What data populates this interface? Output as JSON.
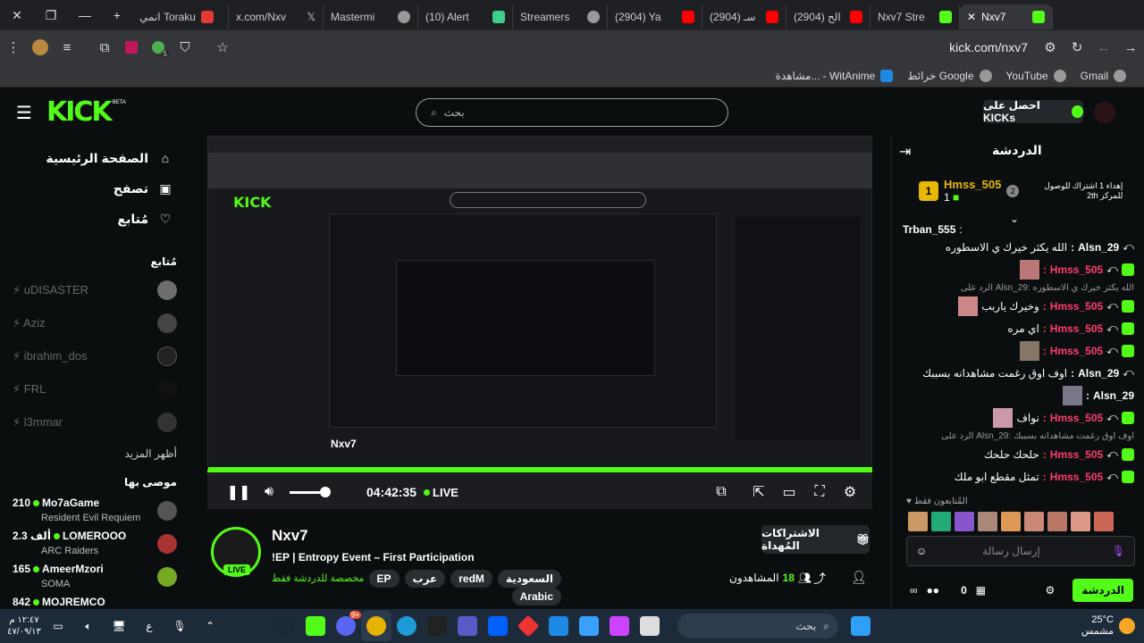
{
  "browser": {
    "tabs": [
      {
        "label": "انمي Toraku",
        "active": false
      },
      {
        "label": "x.com/Nxv",
        "active": false
      },
      {
        "label": "Mastermi",
        "active": false
      },
      {
        "label": "(10) Alert",
        "active": false
      },
      {
        "label": "Streamers",
        "active": false
      },
      {
        "label": "(2904) Ya",
        "active": false
      },
      {
        "label": "(2904) سـ",
        "active": false
      },
      {
        "label": "(2904) الح",
        "active": false
      },
      {
        "label": "Nxv7 Stre",
        "active": false
      },
      {
        "label": "Nxv7",
        "active": true
      }
    ],
    "url": "kick.com/nxv7",
    "extension_badge": "5",
    "bookmarks": [
      "Gmail",
      "YouTube",
      "خرائط Google",
      "مشاهدة... - WitAnime"
    ]
  },
  "header": {
    "logo": "KICK",
    "logo_beta": "BETA",
    "search_placeholder": "بحث",
    "get_kicks": "احصل على KICKs"
  },
  "sidebar": {
    "nav": [
      {
        "label": "الصفحة الرئيسية",
        "icon": "home-icon"
      },
      {
        "label": "تصفح",
        "icon": "browse-icon"
      },
      {
        "label": "مُتابع",
        "icon": "heart-icon"
      }
    ],
    "following_title": "مُتابع",
    "following": [
      "uDISASTER",
      "Aziz",
      "ibrahim_dos",
      "FRL",
      "l3mmar"
    ],
    "show_more": "أظهر المزيد",
    "recommended_title": "موصى بها",
    "recommended": [
      {
        "viewers": "210",
        "name": "Mo7aGame",
        "game": "Resident Evil Requiem"
      },
      {
        "viewers": "2.3 ألف",
        "name": "LOMEROOO",
        "game": "ARC Raiders"
      },
      {
        "viewers": "165",
        "name": "AmeerMzori",
        "game": "SOMA"
      },
      {
        "viewers": "842",
        "name": "MOJREMCO",
        "game": ""
      }
    ]
  },
  "player": {
    "time": "04:42:35",
    "live": "LIVE"
  },
  "stream": {
    "channel": "Nxv7",
    "title": "!EP | Entropy Event – First Participation",
    "avatar_live": "LIVE",
    "chat_only": "مخصصة للدردشة فقط",
    "tags": [
      "السعودية",
      "redM",
      "عرب",
      "EP",
      "Arabic"
    ],
    "gift_subs": "الاشتراكات المُهداة",
    "viewers_label": "المشاهدون",
    "viewers": "18"
  },
  "chat": {
    "title": "الدردشة",
    "pinned_text": "إهداء 1 اشتراك للوصول للمركز 2th",
    "gifter_name": "Hmss_505",
    "gifter_count": "1",
    "gifter_rank": "1",
    "gifter_rank2": "2",
    "messages": [
      {
        "user": "Trban_555",
        "text": "",
        "color": "#ffffff"
      },
      {
        "user": "Alsn_29",
        "text": "الله يكثر خيرك ي الاسطوره",
        "color": "#ffffff"
      },
      {
        "user": "Hmss_505",
        "text": "",
        "color": "#ff3d6e"
      },
      {
        "user": "reply",
        "text": "الرد على Alsn_29: الله يكثر خيرك ي الاسطوره",
        "color": "#999999"
      },
      {
        "user": "Hmss_505",
        "text": "وخيرك ياربب",
        "color": "#ff3d6e"
      },
      {
        "user": "Hmss_505",
        "text": "اي مره",
        "color": "#ff3d6e"
      },
      {
        "user": "Hmss_505",
        "text": "",
        "color": "#ff3d6e"
      },
      {
        "user": "Alsn_29",
        "text": "اوف اوق رغمت مشاهدانه بسببك",
        "color": "#ffffff"
      },
      {
        "user": "Alsn_29",
        "text": "",
        "color": "#ffffff"
      },
      {
        "user": "Hmss_505",
        "text": "نواف",
        "color": "#ff3d6e"
      },
      {
        "user": "reply",
        "text": "الرد على Alsn_29: اوف اوق رغمت مشاهدانه بسببك",
        "color": "#999999"
      },
      {
        "user": "Hmss_505",
        "text": "حلحك حلحك",
        "color": "#ff3d6e"
      },
      {
        "user": "Hmss_505",
        "text": "تمثل مقطع ابو ملك",
        "color": "#ff3d6e"
      }
    ],
    "followers_only": "المُتابعون فقط",
    "input_placeholder": "إرسال رسالة",
    "send": "الدردشة",
    "points": "0"
  },
  "taskbar": {
    "time": "١٢:٤٧ م",
    "date": "٤٧/٠٩/١٣",
    "lang": "ع",
    "search_placeholder": "بحث",
    "weather_temp": "25°C",
    "weather_desc": "مشمس",
    "discord_badge": "9+"
  }
}
